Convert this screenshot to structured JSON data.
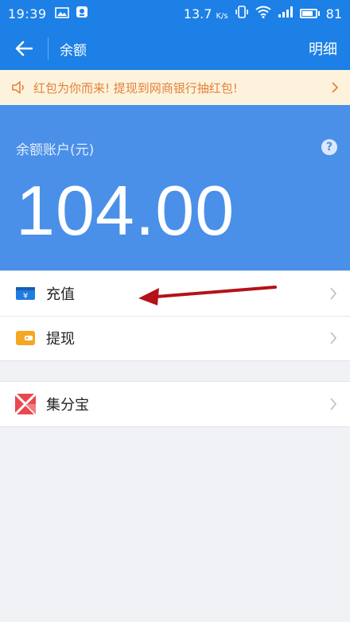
{
  "status_bar": {
    "time": "19:39",
    "network_speed": "13.7",
    "network_unit": "K/s",
    "battery": "81",
    "battery_level": 0.81
  },
  "app_bar": {
    "title": "余额",
    "detail_label": "明细"
  },
  "notice": {
    "text": "红包为你而来! 提现到网商银行抽红包!"
  },
  "balance": {
    "label": "余额账户(元)",
    "amount": "104.00",
    "help_icon": "question-icon"
  },
  "menu": {
    "items": [
      {
        "label": "充值",
        "icon": "recharge-icon",
        "icon_color": "#1f7be0"
      },
      {
        "label": "提现",
        "icon": "withdraw-wallet-icon",
        "icon_color": "#f5a623"
      }
    ]
  },
  "services": {
    "items": [
      {
        "label": "集分宝",
        "icon": "jifenbao-icon",
        "icon_color": "#e8484f"
      }
    ]
  },
  "colors": {
    "primary": "#1c80e6",
    "balance_bg": "#4a90e8",
    "notice_bg": "#fdf3dd",
    "notice_text": "#e3823a",
    "arrow": "#b3121a"
  }
}
